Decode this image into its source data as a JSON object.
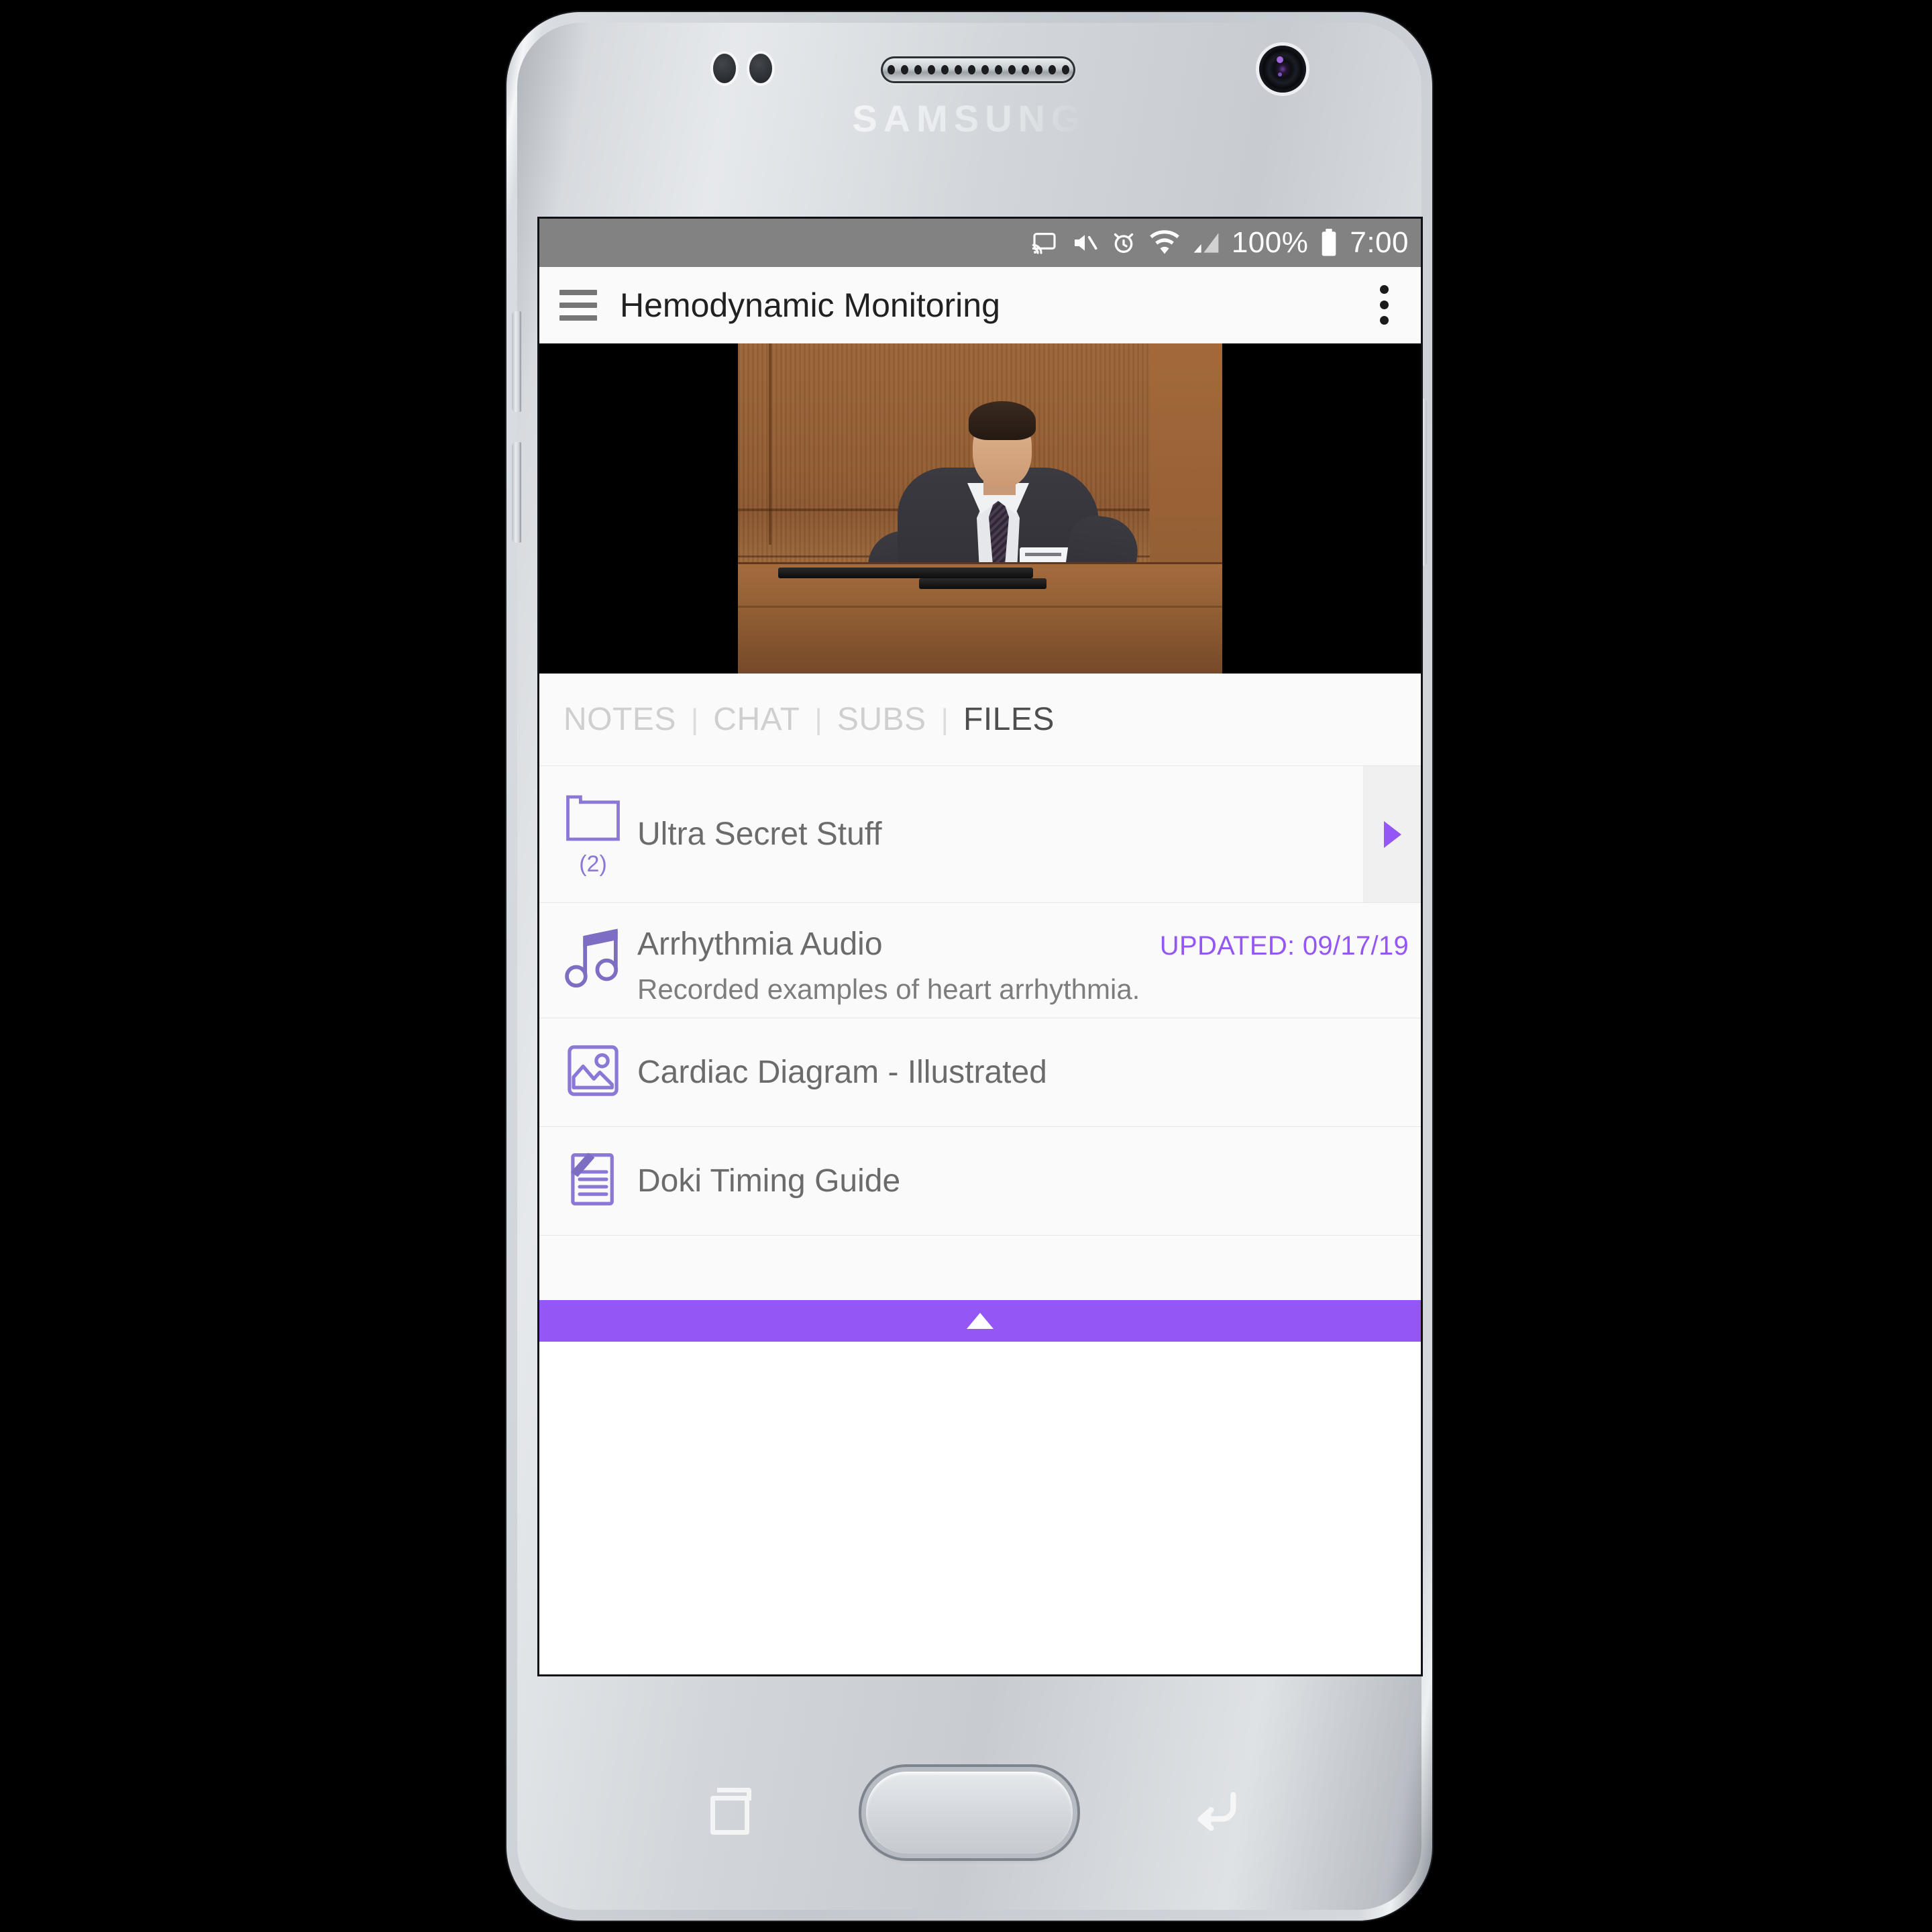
{
  "device": {
    "brand": "SAMSUNG",
    "nav": {
      "recents_label": "Recents",
      "home_label": "Home",
      "back_label": "Back"
    }
  },
  "statusbar": {
    "icons": [
      "cast-icon",
      "mute-icon",
      "alarm-icon",
      "wifi-icon",
      "signal-icon",
      "battery-icon"
    ],
    "battery_percent": "100%",
    "time": "7:00"
  },
  "appbar": {
    "menu_icon": "hamburger-icon",
    "title": "Hemodynamic Monitoring",
    "overflow_icon": "kebab-menu-icon"
  },
  "video": {
    "description": "Lecture video still: presenter in dark suit at wooden podium"
  },
  "tabs": {
    "separator": "|",
    "items": [
      {
        "label": "NOTES",
        "active": false
      },
      {
        "label": "CHAT",
        "active": false
      },
      {
        "label": "SUBS",
        "active": false
      },
      {
        "label": "FILES",
        "active": true
      }
    ]
  },
  "files": {
    "rows": [
      {
        "kind": "folder",
        "icon": "folder-icon",
        "title": "Ultra Secret Stuff",
        "count": "(2)",
        "chevron": "chevron-right-icon"
      },
      {
        "kind": "audio",
        "icon": "music-note-icon",
        "title": "Arrhythmia Audio",
        "updated": "UPDATED: 09/17/19",
        "subtitle": "Recorded examples of heart arrhythmia."
      },
      {
        "kind": "image",
        "icon": "image-icon",
        "title": "Cardiac Diagram - Illustrated"
      },
      {
        "kind": "document",
        "icon": "document-icon",
        "title": "Doki Timing Guide"
      }
    ]
  },
  "handle": {
    "icon": "caret-up-icon",
    "label": ""
  },
  "colors": {
    "accent_purple": "#9457f5",
    "icon_purple": "#8b78d6",
    "statusbar_gray": "#828282",
    "panel_bg": "#fafafa",
    "title_gray": "#6b6b6b"
  }
}
